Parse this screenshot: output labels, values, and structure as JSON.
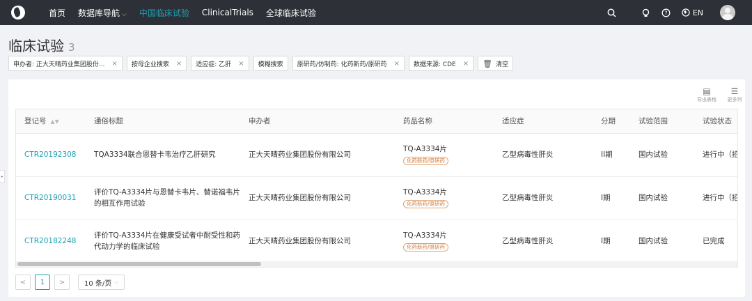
{
  "nav": {
    "items": [
      {
        "label": "首页",
        "active": false
      },
      {
        "label": "数据库导航",
        "active": false,
        "dropdown": true
      },
      {
        "label": "中国临床试验",
        "active": true
      },
      {
        "label": "ClinicalTrials",
        "active": false
      },
      {
        "label": "全球临床试验",
        "active": false
      }
    ],
    "lang": "EN",
    "icons": [
      "search-icon",
      "bulb-icon",
      "help-icon",
      "globe-icon"
    ]
  },
  "page": {
    "title": "临床试验",
    "count": "3"
  },
  "filters": [
    {
      "label": "申办者: 正大天晴药业集团股份..."
    },
    {
      "label": "按母企业搜索"
    },
    {
      "label": "适应症: 乙肝"
    },
    {
      "label": "模糊搜索"
    },
    {
      "label": "原研药/仿制药: 化药新药/原研药"
    },
    {
      "label": "数据来源: CDE"
    }
  ],
  "clear_label": "清空",
  "tools": {
    "export_label": "导出表格",
    "more_label": "更多列"
  },
  "table": {
    "columns": [
      "登记号",
      "通俗标题",
      "申办者",
      "药品名称",
      "适应症",
      "分期",
      "试验范围",
      "试验状态"
    ],
    "rows": [
      {
        "id": "CTR20192308",
        "title": "TQA3334联合恩替卡韦治疗乙肝研究",
        "sponsor": "正大天晴药业集团股份有限公司",
        "drug": "TQ-A3334片",
        "drug_tag": "化药新药/原研药",
        "indication": "乙型病毒性肝炎",
        "phase": "II期",
        "scope": "国内试验",
        "status": "进行中（招"
      },
      {
        "id": "CTR20190031",
        "title": "评价TQ-A3334片与恩替卡韦片、替诺福韦片的相互作用试验",
        "sponsor": "正大天晴药业集团股份有限公司",
        "drug": "TQ-A3334片",
        "drug_tag": "化药新药/原研药",
        "indication": "乙型病毒性肝炎",
        "phase": "I期",
        "scope": "国内试验",
        "status": "进行中（招"
      },
      {
        "id": "CTR20182248",
        "title": "评价TQ-A3334片在健康受试者中耐受性和药代动力学的临床试验",
        "sponsor": "正大天晴药业集团股份有限公司",
        "drug": "TQ-A3334片",
        "drug_tag": "化药新药/原研药",
        "indication": "乙型病毒性肝炎",
        "phase": "I期",
        "scope": "国内试验",
        "status": "已完成"
      }
    ]
  },
  "pagination": {
    "prev": "<",
    "current": "1",
    "next": ">",
    "page_size": "10 条/页"
  },
  "colors": {
    "topbar": "#2d3037",
    "accent": "#1aa1b3",
    "tag": "#d07a3a"
  }
}
